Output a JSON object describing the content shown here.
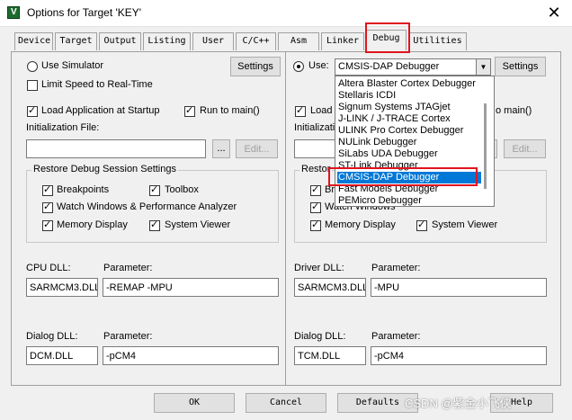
{
  "window": {
    "title": "Options for Target 'KEY'",
    "close_glyph": "✕",
    "app_icon": "uvision-icon"
  },
  "tabs": [
    {
      "label": "Device",
      "active": false
    },
    {
      "label": "Target",
      "active": false
    },
    {
      "label": "Output",
      "active": false
    },
    {
      "label": "Listing",
      "active": false
    },
    {
      "label": "User",
      "active": false
    },
    {
      "label": "C/C++",
      "active": false
    },
    {
      "label": "Asm",
      "active": false
    },
    {
      "label": "Linker",
      "active": false
    },
    {
      "label": "Debug",
      "active": true
    },
    {
      "label": "Utilities",
      "active": false
    }
  ],
  "left": {
    "use_simulator_label": "Use Simulator",
    "use_simulator_selected": false,
    "settings_label": "Settings",
    "limit_speed_label": "Limit Speed to Real-Time",
    "limit_speed_checked": false,
    "load_app_label": "Load Application at Startup",
    "load_app_checked": true,
    "run_to_main_label": "Run to main()",
    "run_to_main_checked": true,
    "init_file_label": "Initialization File:",
    "init_file_value": "",
    "browse_label": "...",
    "edit_label": "Edit...",
    "restore_group_label": "Restore Debug Session Settings",
    "breakpoints_label": "Breakpoints",
    "toolbox_label": "Toolbox",
    "watch_label": "Watch Windows & Performance Analyzer",
    "memory_label": "Memory Display",
    "system_viewer_label": "System Viewer",
    "cpu_dll_label": "CPU DLL:",
    "cpu_dll_value": "SARMCM3.DLL",
    "cpu_param_label": "Parameter:",
    "cpu_param_value": "-REMAP -MPU",
    "dialog_dll_label": "Dialog DLL:",
    "dialog_dll_value": "DCM.DLL",
    "dialog_param_label": "Parameter:",
    "dialog_param_value": "-pCM4"
  },
  "right": {
    "use_label": "Use:",
    "use_selected": true,
    "debugger_value": "CMSIS-DAP Debugger",
    "settings_label": "Settings",
    "load_label": "Load",
    "run_to_main_label": "o main()",
    "init_label": "Initializatio",
    "browse_label": "...",
    "edit_label": "Edit...",
    "restore_label": "Restor",
    "breakpoints_label": "Bre",
    "watch_label": "Watch Windows",
    "memory_label": "Memory Display",
    "system_viewer_label": "System Viewer",
    "driver_dll_label": "Driver DLL:",
    "driver_dll_value": "SARMCM3.DLL",
    "driver_param_label": "Parameter:",
    "driver_param_value": "-MPU",
    "dialog_dll_label": "Dialog DLL:",
    "dialog_dll_value": "TCM.DLL",
    "dialog_param_label": "Parameter:",
    "dialog_param_value": "-pCM4"
  },
  "dropdown": {
    "items": [
      "Altera Blaster Cortex Debugger",
      "Stellaris ICDI",
      "Signum Systems JTAGjet",
      "J-LINK / J-TRACE Cortex",
      "ULINK Pro Cortex Debugger",
      "NULink Debugger",
      "SiLabs UDA Debugger",
      "ST-Link Debugger",
      "CMSIS-DAP Debugger",
      "Fast Models Debugger",
      "PEMicro Debugger"
    ],
    "selected_index": 8
  },
  "buttons": {
    "ok": "OK",
    "cancel": "Cancel",
    "defaults": "Defaults",
    "help": "Help"
  },
  "watermark": "CSDN @紫金小飞侠",
  "colors": {
    "highlight_red": "#e0141e",
    "selection_blue": "#0078d7"
  }
}
